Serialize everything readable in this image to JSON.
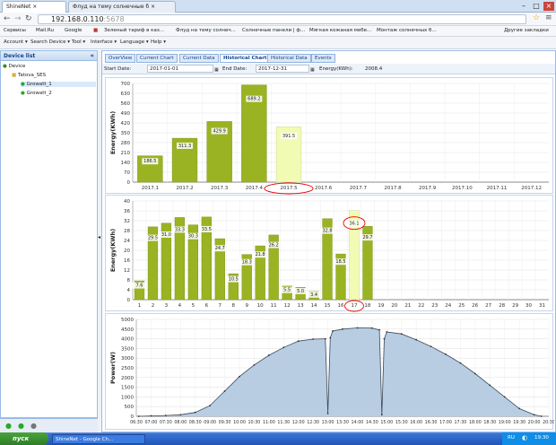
{
  "browser": {
    "tabs": [
      {
        "label": "ShineNet"
      },
      {
        "label": "Флуд на тему солнечные б"
      }
    ],
    "url": {
      "host": "192.168.0.110",
      "port": ":5678"
    },
    "bookmarks": [
      "Сервисы",
      "Mail.Ru",
      "Google",
      "",
      "Зеленый тариф в каз...",
      "Флуд на тему солнеч...",
      "Солнечные панели | ф...",
      "Мягкая кожаная мебе...",
      "Монтаж солнечных б..."
    ],
    "other_bookmarks": "Другие закладки"
  },
  "menu": [
    "Account",
    "Search Device",
    "Tool",
    "Interface",
    "Language",
    "Help"
  ],
  "sidebar": {
    "title": "Device list",
    "tree": [
      {
        "label": "Device",
        "level": 0
      },
      {
        "label": "Tatova_SES",
        "level": 1
      },
      {
        "label": "Growatt_1",
        "level": 2
      },
      {
        "label": "Growatt_2",
        "level": 2
      }
    ]
  },
  "content_tabs": [
    "OverView",
    "Current Chart",
    "Current Data",
    "Historical Chart",
    "Historical Data",
    "Events"
  ],
  "filter": {
    "start_label": "Start Date:",
    "start_value": "2017-01-01",
    "end_label": "End Date:",
    "end_value": "2017-12-31",
    "energy_label": "Energy(KWh):",
    "energy_value": "2008.4"
  },
  "taskbar": {
    "start": "пуск",
    "task": "ShineNet - Google Ch...",
    "lang": "RU",
    "time": "19:30"
  },
  "chart_data": [
    {
      "type": "bar",
      "ylabel": "Energy(KWh)",
      "ylim": [
        0,
        700
      ],
      "yticks": [
        0,
        70,
        140,
        210,
        280,
        350,
        420,
        490,
        560,
        630,
        700
      ],
      "categories": [
        "2017.1",
        "2017.2",
        "2017.3",
        "2017.4",
        "2017.5",
        "2017.6",
        "2017.7",
        "2017.8",
        "2017.9",
        "2017.10",
        "2017.11",
        "2017.12"
      ],
      "values": [
        186.5,
        311.3,
        429.9,
        689.2,
        391.5,
        null,
        null,
        null,
        null,
        null,
        null,
        null
      ],
      "highlight_index": 4,
      "bar_color": "#9ab323",
      "highlight_color": "#f2fbb4"
    },
    {
      "type": "bar",
      "ylabel": "Energy(KWh)",
      "ylim": [
        0,
        40
      ],
      "yticks": [
        0,
        4,
        8,
        12,
        16,
        20,
        24,
        28,
        32,
        36,
        40
      ],
      "categories": [
        "1",
        "2",
        "3",
        "4",
        "5",
        "6",
        "7",
        "8",
        "9",
        "10",
        "11",
        "12",
        "13",
        "14",
        "15",
        "16",
        "17",
        "18",
        "19",
        "20",
        "21",
        "22",
        "23",
        "24",
        "25",
        "26",
        "27",
        "28",
        "29",
        "30",
        "31"
      ],
      "values": [
        7.6,
        29.5,
        31.0,
        33.3,
        30.3,
        33.5,
        24.7,
        10.5,
        18.3,
        21.8,
        26.2,
        5.5,
        5.0,
        3.4,
        32.8,
        18.5,
        36.1,
        29.7,
        null,
        null,
        null,
        null,
        null,
        null,
        null,
        null,
        null,
        null,
        null,
        null,
        null
      ],
      "highlight_index": 16,
      "bar_color": "#9ab323",
      "highlight_color": "#f2fbb4"
    },
    {
      "type": "area",
      "ylabel": "Power(W)",
      "ylim": [
        0,
        5000
      ],
      "yticks": [
        0,
        500,
        1000,
        1500,
        2000,
        2500,
        3000,
        3500,
        4000,
        4500,
        5000
      ],
      "xlim_minutes": [
        390,
        1230
      ],
      "xticks": [
        "06:30",
        "07:00",
        "07:30",
        "08:00",
        "08:30",
        "09:00",
        "09:30",
        "10:00",
        "10:30",
        "11:00",
        "11:30",
        "12:00",
        "12:30",
        "13:00",
        "13:30",
        "14:00",
        "14:30",
        "15:00",
        "15:30",
        "16:00",
        "16:30",
        "17:00",
        "17:30",
        "18:00",
        "18:30",
        "19:00",
        "19:30",
        "20:00",
        "20:30"
      ],
      "x": [
        "06:35",
        "07:00",
        "07:30",
        "08:00",
        "08:30",
        "09:00",
        "09:30",
        "10:00",
        "10:30",
        "11:00",
        "11:30",
        "12:00",
        "12:30",
        "12:55",
        "13:00",
        "13:05",
        "13:10",
        "13:30",
        "14:00",
        "14:30",
        "14:45",
        "14:50",
        "14:55",
        "15:00",
        "15:30",
        "16:00",
        "16:30",
        "17:00",
        "17:30",
        "18:00",
        "18:30",
        "19:00",
        "19:30",
        "20:00",
        "20:15"
      ],
      "values": [
        0,
        20,
        40,
        80,
        200,
        550,
        1300,
        2050,
        2650,
        3150,
        3550,
        3880,
        3980,
        4000,
        150,
        4050,
        4400,
        4500,
        4560,
        4550,
        4460,
        80,
        4000,
        4350,
        4250,
        3950,
        3600,
        3200,
        2750,
        2200,
        1600,
        1000,
        400,
        80,
        0
      ],
      "fill_color": "#b8cde2",
      "line_color": "#3a4a5a"
    }
  ]
}
